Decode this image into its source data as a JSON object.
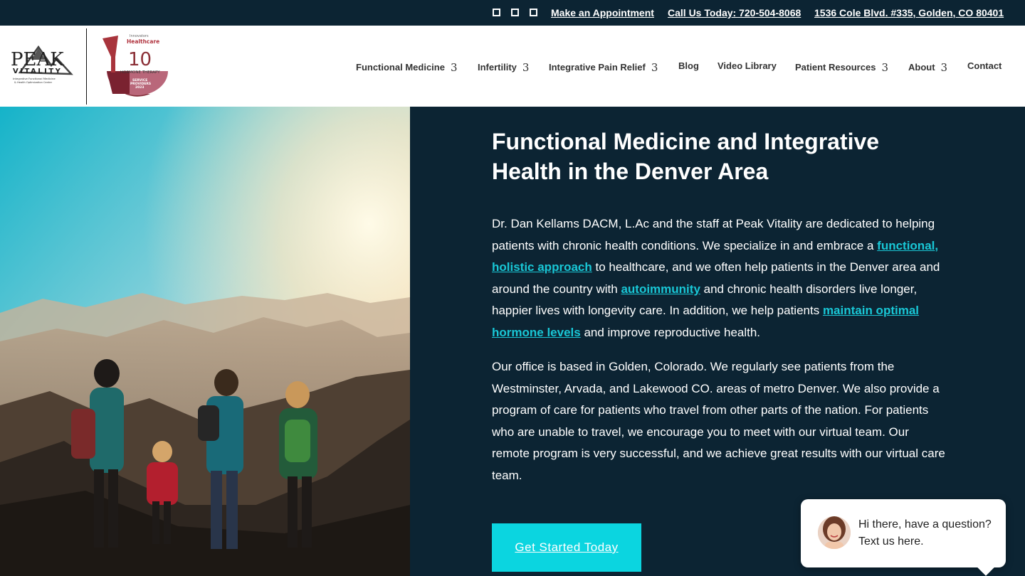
{
  "topbar": {
    "social_icons": [
      "facebook-icon",
      "instagram-icon",
      "youtube-icon"
    ],
    "appointment": "Make an Appointment",
    "phone": "Call Us Today: 720-504-8068",
    "address": "1536 Cole Blvd. #335, Golden, CO 80401"
  },
  "logo": {
    "name_top": "PEAK",
    "name_bottom": "VITALITY",
    "tagline_1": "Integrative Functional Medicine",
    "tagline_2": "& Health Optimization Center"
  },
  "badge": {
    "heading": "Innovators",
    "brand": "Healthcare",
    "number": "10",
    "category": "HORMONE THERAPY",
    "line1": "SERVICE",
    "line2": "PROVIDERS",
    "year": "2023"
  },
  "nav": {
    "functional_medicine": "Functional Medicine",
    "infertility": "Infertility",
    "pain_relief": "Integrative Pain Relief",
    "blog": "Blog",
    "video_library": "Video Library",
    "patient_resources": "Patient Resources",
    "about": "About",
    "contact": "Contact",
    "chevron": "3"
  },
  "hero": {
    "title": "Functional Medicine and Integrative Health in the Denver Area",
    "p1_a": "Dr. Dan Kellams DACM, L.Ac and the staff at Peak Vitality are dedicated to helping patients with chronic health conditions. We specialize in and embrace a ",
    "p1_link1": "functional, holistic approach",
    "p1_b": " to healthcare, and we often help patients in the Denver area and around the country with ",
    "p1_link2": "autoimmunity",
    "p1_c": " and chronic health disorders live longer, happier lives with longevity care. In addition, we help patients ",
    "p1_link3": "maintain optimal hormone levels",
    "p1_d": " and improve reproductive health.",
    "p2": "Our office is based in Golden, Colorado. We regularly see patients from the Westminster, Arvada, and Lakewood CO. areas of metro Denver. We also provide a program of care for patients who travel from other parts of the nation. For patients who are unable to travel, we encourage you to meet with our virtual team. Our remote program is very successful, and we achieve great results with our virtual care team.",
    "cta": "Get Started Today"
  },
  "chat": {
    "message": "Hi there, have a question? Text us here."
  },
  "colors": {
    "navy": "#0c2433",
    "accent_link": "#19c7d6",
    "cta_bg": "#0bd5e0",
    "badge_maroon": "#8b2f36"
  }
}
